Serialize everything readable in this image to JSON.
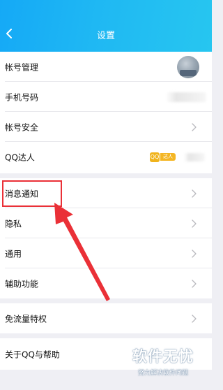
{
  "header": {
    "title": "设置"
  },
  "account_group": {
    "items": [
      {
        "label": "帐号管理"
      },
      {
        "label": "手机号码"
      },
      {
        "label": "帐号安全"
      },
      {
        "label": "QQ达人",
        "badge_icon": "QQ",
        "badge_text": "达人"
      }
    ]
  },
  "general_group": {
    "items": [
      {
        "label": "消息通知"
      },
      {
        "label": "隐私"
      },
      {
        "label": "通用"
      },
      {
        "label": "辅助功能"
      }
    ]
  },
  "traffic_group": {
    "items": [
      {
        "label": "免流量特权"
      }
    ]
  },
  "about_group": {
    "items": [
      {
        "label": "关于QQ与帮助"
      }
    ]
  },
  "watermark": {
    "main": "软件无忧",
    "sub": "努力解决软件问题"
  },
  "colors": {
    "header_start": "#15a9f6",
    "header_end": "#27c6f0",
    "annotation_red": "#ea3037",
    "page_bg": "#efeff4"
  }
}
